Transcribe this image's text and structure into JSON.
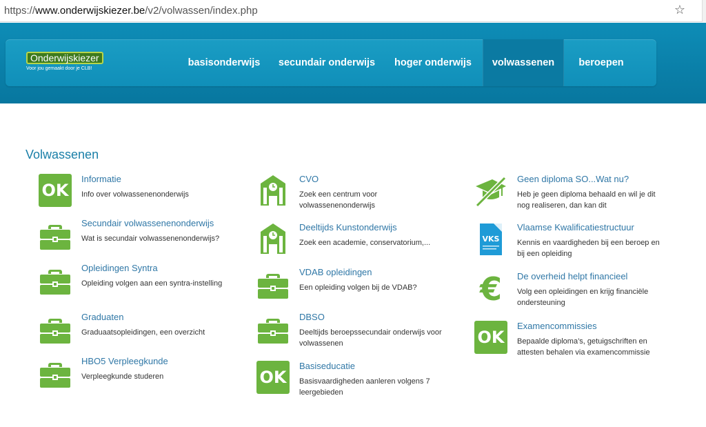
{
  "browser": {
    "url_prefix": "https://",
    "url_host": "www.onderwijskiezer.be",
    "url_path": "/v2/volwassen/index.php"
  },
  "logo": {
    "name": "Onderwijskiezer",
    "tagline": "Voor jou gemaakt door je CLB!"
  },
  "nav": [
    {
      "label": "basisonderwijs"
    },
    {
      "label": "secundair onderwijs"
    },
    {
      "label": "hoger onderwijs"
    },
    {
      "label": "volwassenen",
      "active": true
    },
    {
      "label": "beroepen"
    }
  ],
  "section_title": "Volwassenen",
  "colors": {
    "green": "#6cb43f",
    "link": "#2f77a6",
    "header": "#0e8db7"
  },
  "items": [
    {
      "icon": "ok-icon",
      "ok_text": "OK",
      "title": "Informatie",
      "desc": "Info over volwassenenonderwijs"
    },
    {
      "icon": "briefcase-icon",
      "title": "Secundair volwassenenonderwijs",
      "desc": "Wat is secundair volwassenenonderwijs?"
    },
    {
      "icon": "briefcase-icon",
      "title": "Opleidingen Syntra",
      "desc": "Opleiding volgen aan een syntra-instelling"
    },
    {
      "icon": "briefcase-icon",
      "title": "Graduaten",
      "desc": "Graduaatsopleidingen, een overzicht"
    },
    {
      "icon": "briefcase-icon",
      "title": "HBO5 Verpleegkunde",
      "desc": "Verpleegkunde studeren"
    },
    {
      "icon": "school-building-icon",
      "title": "CVO",
      "desc": "Zoek een centrum voor volwassenenonderwijs"
    },
    {
      "icon": "school-building-icon",
      "title": "Deeltijds Kunstonderwijs",
      "desc": "Zoek een academie, conservatorium,..."
    },
    {
      "icon": "briefcase-icon",
      "title": "VDAB opleidingen",
      "desc": "Een opleiding volgen bij de VDAB?"
    },
    {
      "icon": "briefcase-icon",
      "title": "DBSO",
      "desc": "Deeltijds beroepssecundair onderwijs voor volwassenen"
    },
    {
      "icon": "ok-icon",
      "ok_text": "OK",
      "title": "Basiseducatie",
      "desc": "Basisvaardigheden aanleren volgens 7 leergebieden"
    },
    {
      "icon": "crossed-graduation-cap-icon",
      "title": "Geen diploma SO...Wat nu?",
      "desc": "Heb je geen diploma behaald en wil je dit nog realiseren, dan kan dit"
    },
    {
      "icon": "vks-logo-icon",
      "vks_text": "VKS",
      "title": "Vlaamse Kwalificatiestructuur",
      "desc": "Kennis en vaardigheden bij een beroep en bij een opleiding"
    },
    {
      "icon": "euro-icon",
      "euro_text": "€",
      "title": "De overheid helpt financieel",
      "desc": "Volg een opleidingen en krijg financiële ondersteuning"
    },
    {
      "icon": "ok-icon",
      "ok_text": "OK",
      "title": "Examencommissies",
      "desc": "Bepaalde diploma’s, getuigschriften en attesten behalen via examencommissie"
    }
  ]
}
